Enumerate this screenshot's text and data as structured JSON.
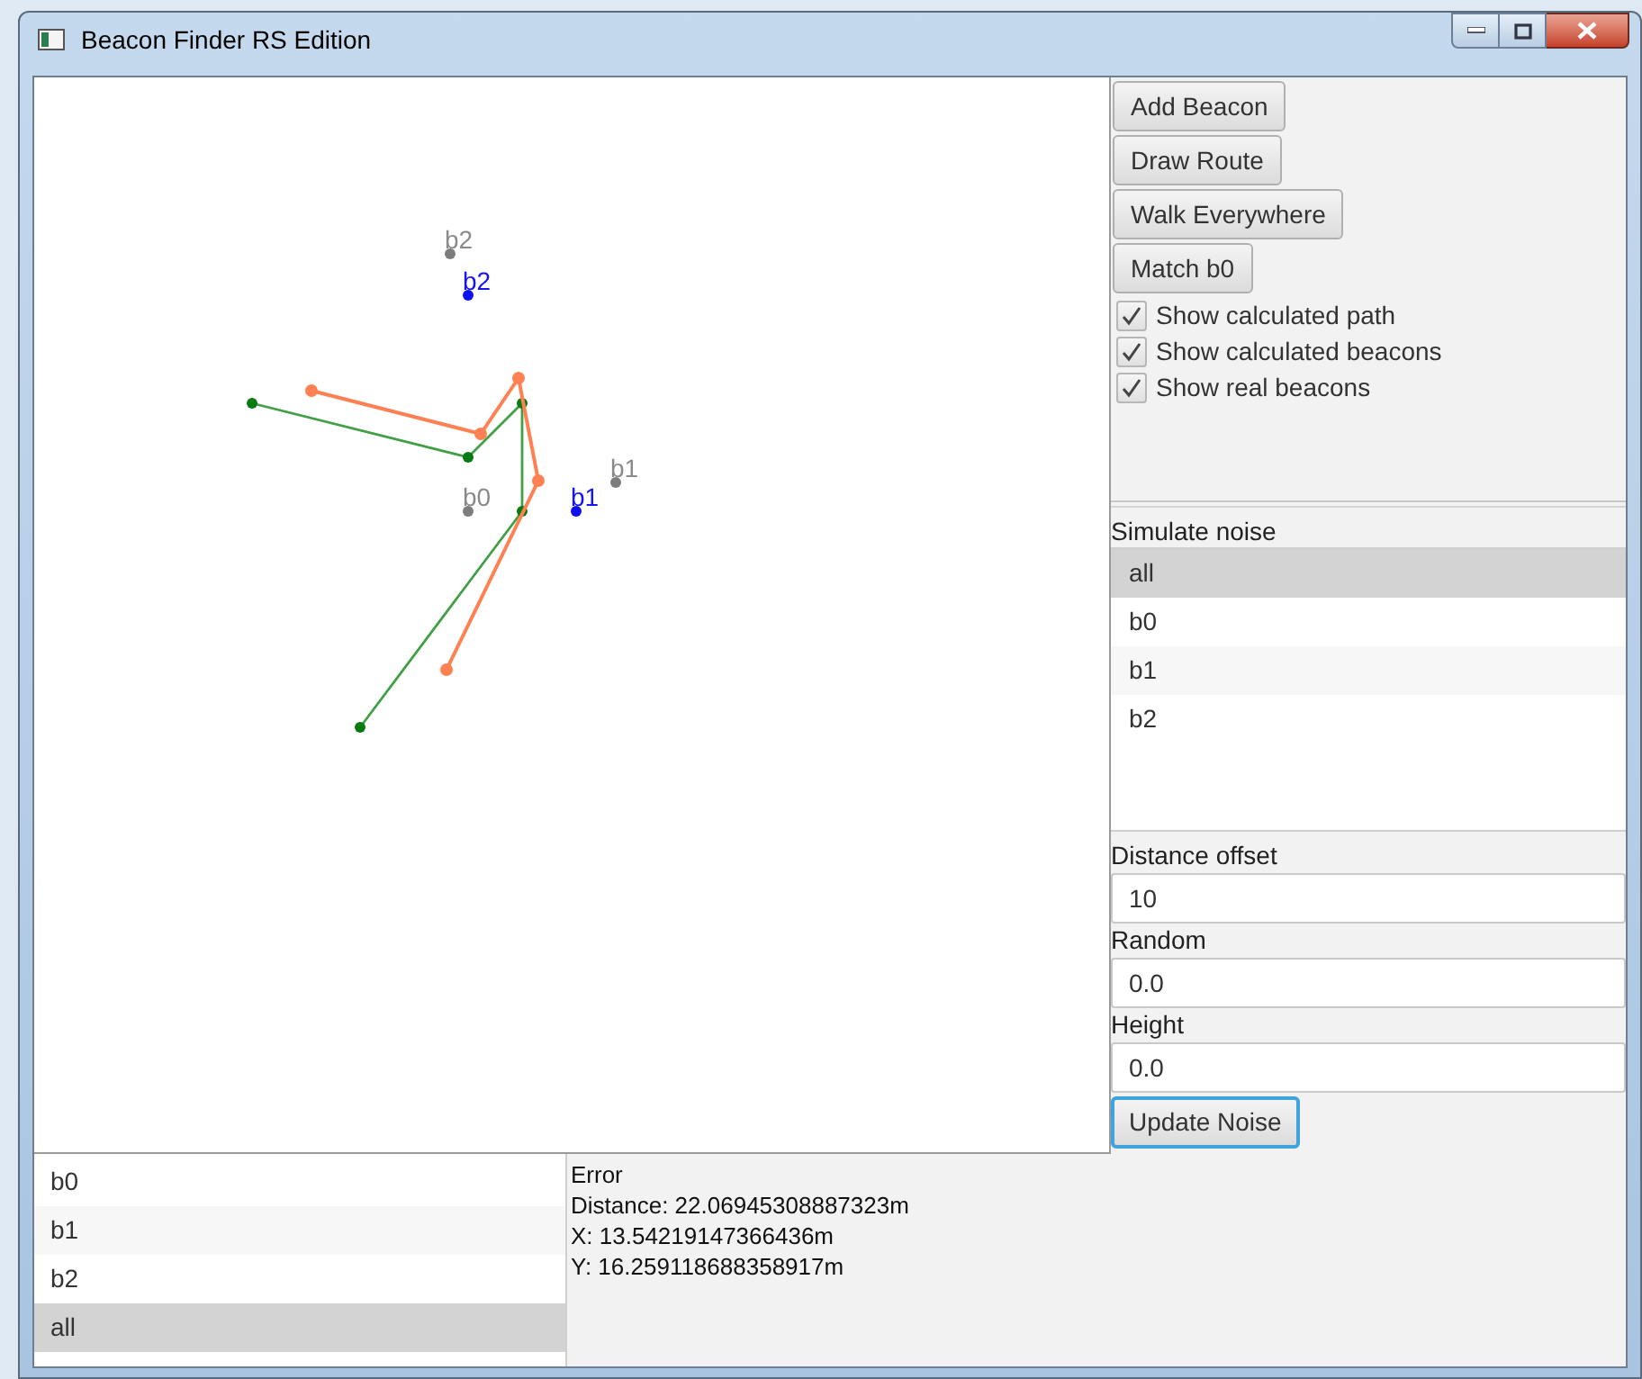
{
  "window": {
    "title": "Beacon Finder RS Edition"
  },
  "canvas": {
    "real_beacons": [
      {
        "label": "b2"
      },
      {
        "label": "b0"
      },
      {
        "label": "b1"
      }
    ],
    "calculated_beacons": [
      {
        "label": "b2"
      },
      {
        "label": "b1"
      }
    ]
  },
  "controls": {
    "buttons": [
      {
        "label": "Add Beacon"
      },
      {
        "label": "Draw Route"
      },
      {
        "label": "Walk Everywhere"
      },
      {
        "label": "Match b0"
      }
    ],
    "checkboxes": [
      {
        "label": "Show calculated path",
        "checked": true
      },
      {
        "label": "Show calculated beacons",
        "checked": true
      },
      {
        "label": "Show real beacons",
        "checked": true
      }
    ]
  },
  "noise": {
    "title": "Simulate noise",
    "items": [
      {
        "label": "all",
        "selected": true
      },
      {
        "label": "b0",
        "selected": false
      },
      {
        "label": "b1",
        "selected": false
      },
      {
        "label": "b2",
        "selected": false
      }
    ],
    "fields": [
      {
        "label": "Distance offset",
        "value": "10"
      },
      {
        "label": "Random",
        "value": "0.0"
      },
      {
        "label": "Height",
        "value": "0.0"
      }
    ],
    "button": {
      "label": "Update Noise",
      "focused": true
    }
  },
  "beacon_list": {
    "items": [
      {
        "label": "b0",
        "selected": false
      },
      {
        "label": "b1",
        "selected": false
      },
      {
        "label": "b2",
        "selected": false
      },
      {
        "label": "all",
        "selected": true
      }
    ]
  },
  "error_info": {
    "lines": [
      "Error",
      "Distance: 22.06945308887323m",
      "X: 13.54219147366436m",
      "Y: 16.259118688358917m"
    ]
  }
}
